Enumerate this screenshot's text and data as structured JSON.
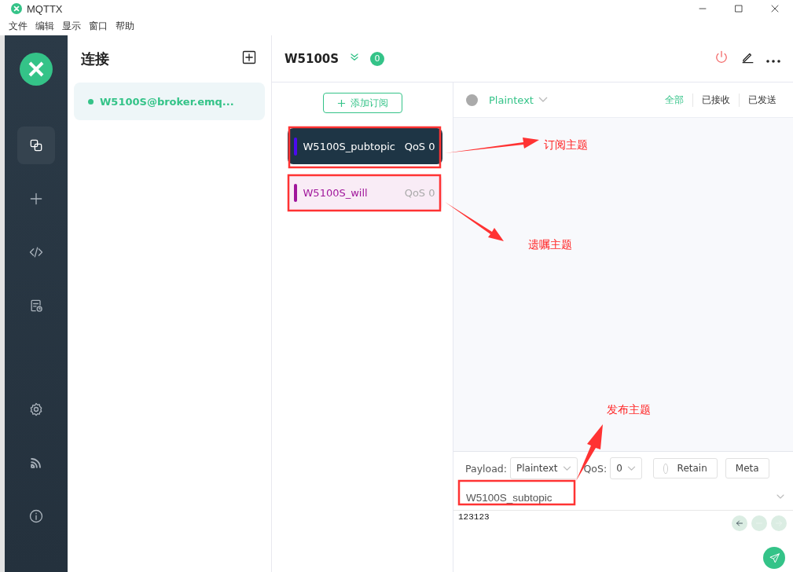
{
  "window": {
    "title": "MQTTX"
  },
  "menu": [
    "文件",
    "编辑",
    "显示",
    "窗口",
    "帮助"
  ],
  "sidebar": {
    "items": [
      {
        "kind": "connections",
        "selected": true
      },
      {
        "kind": "new",
        "selected": false
      },
      {
        "kind": "script",
        "selected": false
      },
      {
        "kind": "log",
        "selected": false
      },
      {
        "kind": "settings",
        "selected": false
      },
      {
        "kind": "feed",
        "selected": false
      },
      {
        "kind": "about",
        "selected": false
      }
    ]
  },
  "connections": {
    "title": "连接",
    "items": [
      {
        "name": "W5100S@broker.emq...",
        "selected": true,
        "color": "#34c388"
      }
    ]
  },
  "header": {
    "name": "W5100S",
    "count": "0"
  },
  "subscriptions": {
    "add_label": "添加订阅",
    "items": [
      {
        "topic": "W5100S_pubtopic",
        "qos": "QoS 0",
        "color": "#4b0af0",
        "selected": true
      },
      {
        "topic": "W5100S_will",
        "qos": "QoS 0",
        "color": "#a0169b",
        "selected": false
      }
    ]
  },
  "messages": {
    "format": "Plaintext",
    "filters": [
      {
        "label": "全部",
        "selected": true
      },
      {
        "label": "已接收",
        "selected": false
      },
      {
        "label": "已发送",
        "selected": false
      }
    ]
  },
  "publish": {
    "payload_label": "Payload:",
    "payload_format": "Plaintext",
    "qos_label": "QoS:",
    "qos": "0",
    "retain": {
      "label": "Retain",
      "checked": false
    },
    "meta_label": "Meta",
    "topic": "W5100S_subtopic",
    "payload": "123123"
  },
  "annotations": [
    {
      "label": "订阅主题"
    },
    {
      "label": "遗嘱主题"
    },
    {
      "label": "发布主题"
    }
  ]
}
